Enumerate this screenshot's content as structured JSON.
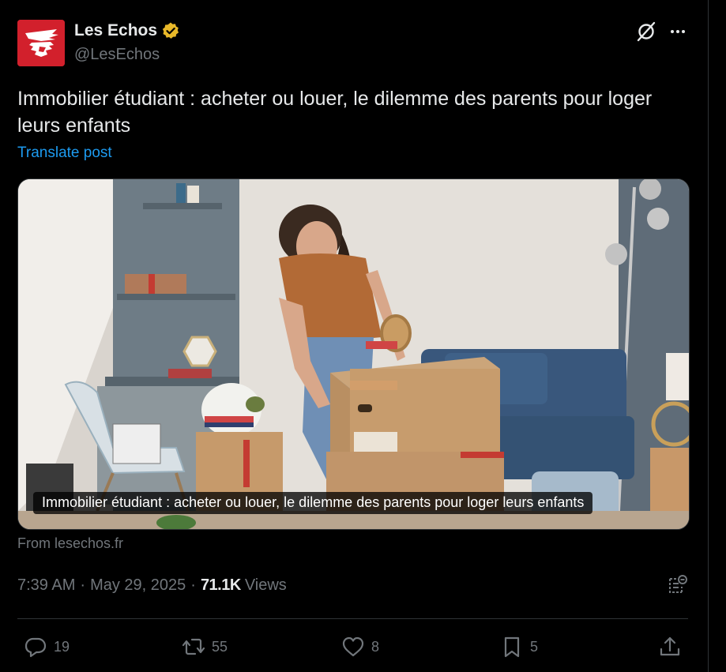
{
  "author": {
    "display_name": "Les Echos",
    "handle": "@LesEchos",
    "verified_color": "#e8b829",
    "brand_color": "#d2202c"
  },
  "post": {
    "text": "Immobilier étudiant : acheter ou louer, le dilemme des parents pour loger leurs enfants",
    "translate_label": "Translate post"
  },
  "card": {
    "caption": "Immobilier étudiant : acheter ou louer, le dilemme des parents pour loger leurs enfants",
    "source": "From lesechos.fr"
  },
  "meta": {
    "time": "7:39 AM",
    "separator": "·",
    "date": "May 29, 2025",
    "views_count": "71.1K",
    "views_label": "Views"
  },
  "actions": {
    "replies": "19",
    "reposts": "55",
    "likes": "8",
    "bookmarks": "5"
  },
  "icons": [
    "grok-icon",
    "more-icon",
    "verified-badge-icon",
    "analytics-icon",
    "reply-icon",
    "repost-icon",
    "like-icon",
    "bookmark-icon",
    "share-icon"
  ],
  "colors": {
    "background": "#000000",
    "text_primary": "#e7e9ea",
    "text_secondary": "#71767b",
    "link": "#1d9bf0",
    "border": "#2f3336"
  }
}
